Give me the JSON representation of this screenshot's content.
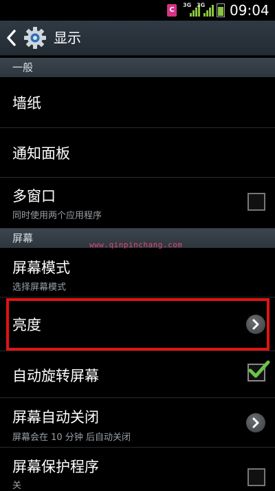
{
  "status_bar": {
    "app_icon_letter": "C",
    "network_1": "3G",
    "network_2": "3G",
    "time": "09:04"
  },
  "action_bar": {
    "title": "显示"
  },
  "sections": {
    "general": "一般",
    "screen": "屏幕"
  },
  "items": {
    "wallpaper": {
      "title": "墙纸"
    },
    "notification_panel": {
      "title": "通知面板"
    },
    "multi_window": {
      "title": "多窗口",
      "subtitle": "同时使用两个应用程序",
      "checked": false
    },
    "screen_mode": {
      "title": "屏幕模式",
      "subtitle": "选择屏幕模式"
    },
    "brightness": {
      "title": "亮度"
    },
    "auto_rotate": {
      "title": "自动旋转屏幕",
      "checked": true
    },
    "screen_timeout": {
      "title": "屏幕自动关闭",
      "subtitle": "屏幕会在 10 分钟 后自动关闭"
    },
    "screen_saver": {
      "title": "屏幕保护程序",
      "subtitle": "关",
      "checked": false
    }
  },
  "watermark": "www.qinpinchang.com",
  "colors": {
    "highlight": "#e01414",
    "check_green": "#6cc24a",
    "watermark": "#e0457a"
  }
}
